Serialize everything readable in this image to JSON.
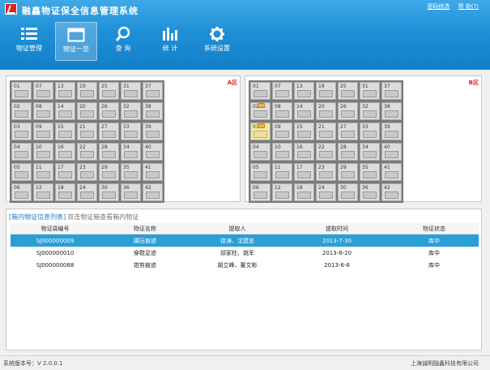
{
  "app": {
    "title": "融鑫物证保全信息管理系统",
    "links": [
      "密码修改",
      "帮 助(?)"
    ]
  },
  "toolbar": [
    {
      "label": "物证管理",
      "icon": "list-icon",
      "active": false
    },
    {
      "label": "物证一览",
      "icon": "window-icon",
      "active": true
    },
    {
      "label": "查 询",
      "icon": "search-icon",
      "active": false
    },
    {
      "label": "统 计",
      "icon": "bar-chart-icon",
      "active": false
    },
    {
      "label": "系统设置",
      "icon": "gear-icon",
      "active": false
    }
  ],
  "zones": [
    {
      "label": "A区",
      "cells": [
        "01",
        "07",
        "13",
        "19",
        "25",
        "31",
        "37",
        "02",
        "08",
        "14",
        "20",
        "26",
        "32",
        "38",
        "03",
        "09",
        "15",
        "21",
        "27",
        "33",
        "39",
        "04",
        "10",
        "16",
        "22",
        "28",
        "34",
        "40",
        "05",
        "11",
        "17",
        "23",
        "29",
        "35",
        "41",
        "06",
        "12",
        "18",
        "24",
        "30",
        "36",
        "42"
      ],
      "occupied": [],
      "highlighted": []
    },
    {
      "label": "B区",
      "cells": [
        "01",
        "07",
        "13",
        "19",
        "25",
        "31",
        "37",
        "02",
        "08",
        "14",
        "20",
        "26",
        "32",
        "38",
        "03",
        "09",
        "15",
        "21",
        "27",
        "33",
        "39",
        "04",
        "10",
        "16",
        "22",
        "28",
        "34",
        "40",
        "05",
        "11",
        "17",
        "23",
        "29",
        "35",
        "41",
        "06",
        "12",
        "18",
        "24",
        "30",
        "36",
        "42"
      ],
      "occupied": [
        "02",
        "03"
      ],
      "highlighted": [
        "03"
      ]
    }
  ],
  "list": {
    "title": "[箱内物证信息列表]",
    "hint": "双击物证箱查看箱内物证",
    "columns": [
      "物证袋编号",
      "物证名称",
      "提取人",
      "提取时间",
      "物证状态"
    ],
    "rows": [
      {
        "id": "SJ000000009",
        "name": "踝压痕迹",
        "person": "徐涛、沈建忠",
        "time": "2013-7-30",
        "status": "库中",
        "selected": true
      },
      {
        "id": "SJ000000010",
        "name": "穿鞋足迹",
        "person": "邱家柱、姚军",
        "time": "2013-8-20",
        "status": "库中",
        "selected": false
      },
      {
        "id": "SJ000000088",
        "name": "钳剪痕迹",
        "person": "胡立峰、董文彬",
        "time": "2013-6-6",
        "status": "库中",
        "selected": false
      }
    ]
  },
  "status": {
    "version": "系统版本号：V 2.0.0.1",
    "company": "上海诚明融鑫科技有限公司"
  }
}
